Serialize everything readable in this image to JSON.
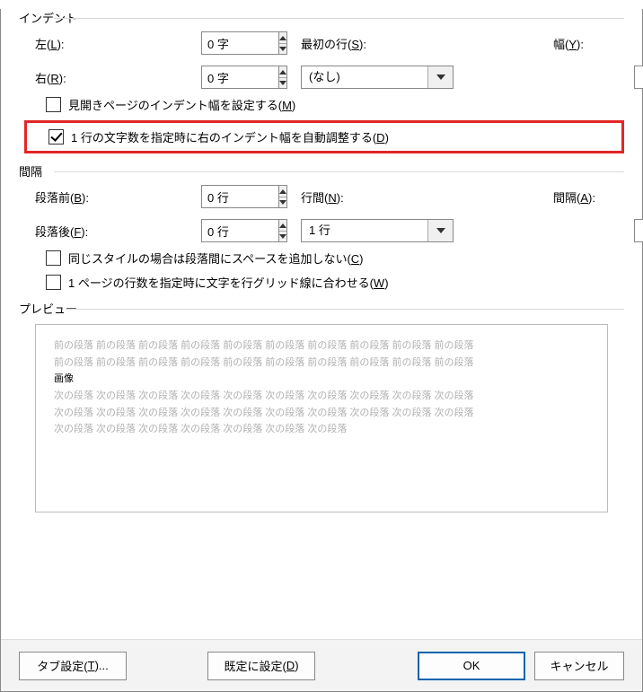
{
  "sections": {
    "indent_title": "インデント",
    "spacing_title": "間隔",
    "preview_title": "プレビュー"
  },
  "indent": {
    "left_label_pre": "左(",
    "left_label_hot": "L",
    "left_label_post": "):",
    "left_value": "0 字",
    "right_label_pre": "右(",
    "right_label_hot": "R",
    "right_label_post": "):",
    "right_value": "0 字",
    "firstline_label_pre": "最初の行(",
    "firstline_label_hot": "S",
    "firstline_label_post": "):",
    "firstline_value": "(なし)",
    "width_label_pre": "幅(",
    "width_label_hot": "Y",
    "width_label_post": "):",
    "width_value": ""
  },
  "indent_checks": {
    "mirror_pre": "見開きページのインデント幅を設定する(",
    "mirror_hot": "M",
    "mirror_post": ")",
    "mirror_checked": false,
    "auto_pre": "1 行の文字数を指定時に右のインデント幅を自動調整する(",
    "auto_hot": "D",
    "auto_post": ")",
    "auto_checked": true
  },
  "spacing": {
    "before_label_pre": "段落前(",
    "before_label_hot": "B",
    "before_label_post": "):",
    "before_value": "0 行",
    "after_label_pre": "段落後(",
    "after_label_hot": "F",
    "after_label_post": "):",
    "after_value": "0 行",
    "line_label_pre": "行間(",
    "line_label_hot": "N",
    "line_label_post": "):",
    "line_value": "1 行",
    "at_label_pre": "間隔(",
    "at_label_hot": "A",
    "at_label_post": "):",
    "at_value": ""
  },
  "spacing_checks": {
    "same_style_pre": "同じスタイルの場合は段落間にスペースを追加しない(",
    "same_style_hot": "C",
    "same_style_post": ")",
    "grid_pre": "1 ページの行数を指定時に文字を行グリッド線に合わせる(",
    "grid_hot": "W",
    "grid_post": ")"
  },
  "preview": {
    "prev_token": "前の段落",
    "next_token": "次の段落",
    "sample_text": "画像",
    "prev_repeat": 10,
    "next_repeat_full": 10,
    "next_repeat_last": 7,
    "prev_lines": 2,
    "next_full_lines": 2
  },
  "buttons": {
    "tabs_pre": "タブ設定(",
    "tabs_hot": "T",
    "tabs_post": ")...",
    "default_pre": "既定に設定(",
    "default_hot": "D",
    "default_post": ")",
    "ok": "OK",
    "cancel": "キャンセル"
  }
}
